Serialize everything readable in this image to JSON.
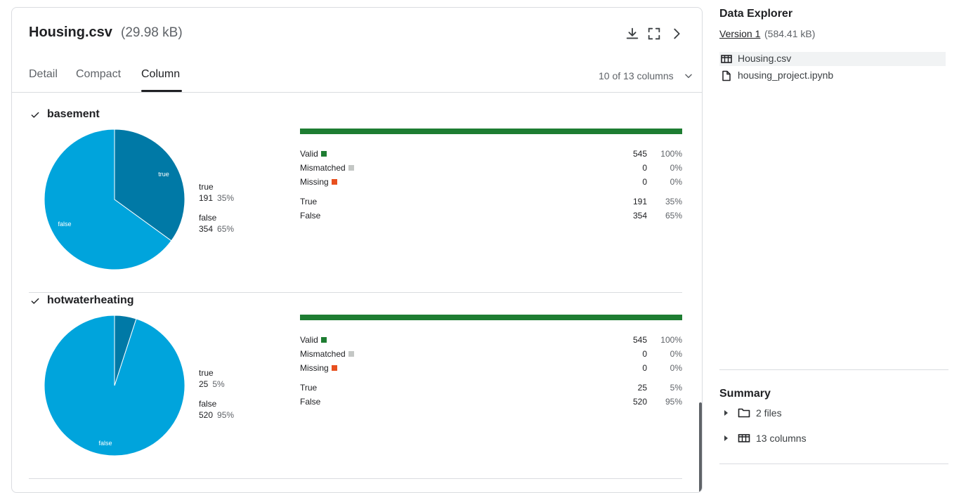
{
  "file": {
    "name": "Housing.csv",
    "size": "(29.98 kB)"
  },
  "header_icons": [
    "download-icon",
    "fullscreen-icon",
    "chevron-right-icon"
  ],
  "tabs": [
    {
      "label": "Detail",
      "active": false
    },
    {
      "label": "Compact",
      "active": false
    },
    {
      "label": "Column",
      "active": true
    }
  ],
  "columns_selector": {
    "label": "10 of 13 columns"
  },
  "sections": [
    {
      "name": "basement",
      "pie": {
        "true_fraction": 0.35,
        "false_fraction": 0.65,
        "true_label": "true",
        "false_label": "false"
      },
      "legend": [
        {
          "label": "true",
          "count": "191",
          "pct": "35%"
        },
        {
          "label": "false",
          "count": "354",
          "pct": "65%"
        }
      ],
      "stats": [
        {
          "label": "Valid",
          "swatch": "#1e7d32",
          "count": "545",
          "pct": "100%"
        },
        {
          "label": "Mismatched",
          "swatch": "#c4c7c5",
          "count": "0",
          "pct": "0%"
        },
        {
          "label": "Missing",
          "swatch": "#e8501f",
          "count": "0",
          "pct": "0%"
        }
      ],
      "values": [
        {
          "label": "True",
          "count": "191",
          "pct": "35%"
        },
        {
          "label": "False",
          "count": "354",
          "pct": "65%"
        }
      ]
    },
    {
      "name": "hotwaterheating",
      "pie": {
        "true_fraction": 0.05,
        "false_fraction": 0.95,
        "true_label": "",
        "false_label": "false"
      },
      "legend": [
        {
          "label": "true",
          "count": "25",
          "pct": "5%"
        },
        {
          "label": "false",
          "count": "520",
          "pct": "95%"
        }
      ],
      "stats": [
        {
          "label": "Valid",
          "swatch": "#1e7d32",
          "count": "545",
          "pct": "100%"
        },
        {
          "label": "Mismatched",
          "swatch": "#c4c7c5",
          "count": "0",
          "pct": "0%"
        },
        {
          "label": "Missing",
          "swatch": "#e8501f",
          "count": "0",
          "pct": "0%"
        }
      ],
      "values": [
        {
          "label": "True",
          "count": "25",
          "pct": "5%"
        },
        {
          "label": "False",
          "count": "520",
          "pct": "95%"
        }
      ]
    }
  ],
  "colors": {
    "true_slice": "#0079a6",
    "false_slice": "#00a4dc",
    "valid_bar": "#1e7d32"
  },
  "explorer": {
    "title": "Data Explorer",
    "version": "Version 1",
    "version_size": "(584.41 kB)",
    "files": [
      {
        "name": "Housing.csv",
        "icon": "table-icon",
        "selected": true
      },
      {
        "name": "housing_project.ipynb",
        "icon": "file-icon",
        "selected": false
      }
    ]
  },
  "summary": {
    "title": "Summary",
    "items": [
      {
        "label": "2 files",
        "icon": "folder-icon"
      },
      {
        "label": "13 columns",
        "icon": "table-icon"
      }
    ]
  }
}
